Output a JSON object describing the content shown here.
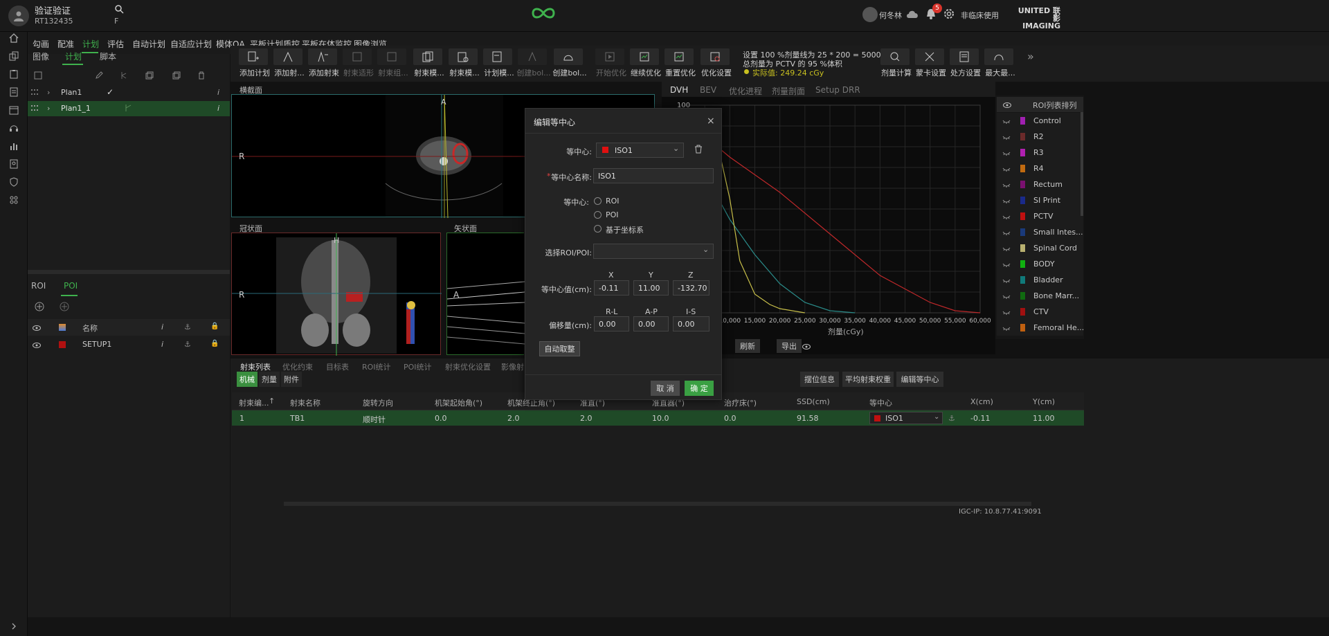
{
  "header": {
    "patient_name": "验证验证",
    "patient_id": "RT132435",
    "patient_sex": "F",
    "user_name": "何冬林",
    "notification_count": "5",
    "mode_label": "非临床使用",
    "brand_line1": "UNITED 联影",
    "brand_line2": "IMAGING"
  },
  "menu": [
    "勾画",
    "配准",
    "计划",
    "评估",
    "自动计划",
    "自适应计划",
    "模体QA",
    "平板计划质控",
    "平板在体监控",
    "图像浏览"
  ],
  "left_panel": {
    "tabs": [
      "图像",
      "计划",
      "脚本"
    ],
    "plans": [
      {
        "name": "Plan1",
        "info": "i"
      },
      {
        "name": "Plan1_1",
        "info": "i"
      }
    ],
    "lower_tabs": [
      "ROI",
      "POI"
    ],
    "poi_header": {
      "name": "名称",
      "info": "i"
    },
    "poi_rows": [
      {
        "name": "SETUP1",
        "info": "i"
      }
    ]
  },
  "toolbar": {
    "items": [
      "添加计划",
      "添加射...",
      "添加射束",
      "射束适形",
      "射束组...",
      "射束模...",
      "射束模...",
      "计划模...",
      "创建bol...",
      "创建bol...",
      "开始优化",
      "继续优化",
      "重置优化",
      "优化设置"
    ],
    "prescription_line1": "设置 100 %剂量线为 25 * 200 = 5000 cGy",
    "prescription_line2": "总剂量为 PCTV 的 95 %体积",
    "actual_value": "实际值: 249.24 cGy",
    "right_items": [
      "剂量计算",
      "蒙卡设置",
      "处方设置",
      "最大最..."
    ],
    "more": "»"
  },
  "views": {
    "axial_title": "横截面",
    "coronal_title": "冠状面",
    "sagittal_title": "矢状面",
    "axial_left": "R",
    "axial_top": "A",
    "coronal_left": "R",
    "coronal_top": "H",
    "sagittal_left": "A"
  },
  "dvh_tabs": [
    "DVH",
    "BEV",
    "优化进程",
    "剂量剖面",
    "Setup DRR"
  ],
  "chart_data": {
    "type": "line",
    "xlabel": "剂量(cGy)",
    "ylabel": "",
    "x_ticks": [
      "10,000",
      "15,000",
      "20,000",
      "25,000",
      "30,000",
      "35,000",
      "40,000",
      "45,000",
      "50,000",
      "55,000",
      "60,000"
    ],
    "y_tick_top": "100",
    "xlim": [
      0,
      60000
    ],
    "ylim": [
      0,
      100
    ],
    "series": [
      {
        "color": "#c0282a",
        "x": [
          7500,
          10000,
          20000,
          30000,
          40000,
          50000,
          55000,
          60000
        ],
        "y": [
          80,
          75,
          58,
          38,
          18,
          5,
          1,
          0
        ]
      },
      {
        "color": "#2a8c8a",
        "x": [
          7500,
          10000,
          15000,
          20000,
          25000,
          30000,
          35000
        ],
        "y": [
          56,
          45,
          28,
          14,
          5,
          1,
          0
        ]
      },
      {
        "color": "#c9c04a",
        "x": [
          7500,
          10000,
          12000,
          15000,
          18000,
          20000,
          25000
        ],
        "y": [
          82,
          55,
          25,
          9,
          4,
          2,
          0
        ]
      }
    ]
  },
  "dvh_footer": {
    "refresh": "刷新",
    "export": "导出"
  },
  "roi_list": {
    "header": "ROI列表排列",
    "items": [
      {
        "name": "Control",
        "color": "#a020b0"
      },
      {
        "name": "R2",
        "color": "#6b2a2a"
      },
      {
        "name": "R3",
        "color": "#b020b0"
      },
      {
        "name": "R4",
        "color": "#c06a10"
      },
      {
        "name": "Rectum",
        "color": "#7a1070"
      },
      {
        "name": "SI Print",
        "color": "#1a2a8a"
      },
      {
        "name": "PCTV",
        "color": "#c01010"
      },
      {
        "name": "Small Intes...",
        "color": "#1a3a7a"
      },
      {
        "name": "Spinal Cord",
        "color": "#b8b070"
      },
      {
        "name": "BODY",
        "color": "#10b010"
      },
      {
        "name": "Bladder",
        "color": "#107a7a"
      },
      {
        "name": "Bone Marr...",
        "color": "#106a10"
      },
      {
        "name": "CTV",
        "color": "#a01010"
      },
      {
        "name": "Femoral He...",
        "color": "#c06010"
      }
    ]
  },
  "bottom": {
    "tabs": [
      "射束列表",
      "优化约束",
      "目标表",
      "ROI统计",
      "POI统计",
      "射束优化设置",
      "影像射"
    ],
    "subtabs": [
      "机械",
      "剂量",
      "附件"
    ],
    "right_buttons": [
      "摆位信息",
      "平均射束权重",
      "编辑等中心"
    ],
    "columns": [
      "射束编...",
      "射束名称",
      "旋转方向",
      "机架起始角(°)",
      "机架终止角(°)",
      "准直(°)",
      "准直器(°)",
      "治疗床(°)",
      "SSD(cm)",
      "等中心",
      "X(cm)",
      "Y(cm)"
    ],
    "row": [
      "1",
      "TB1",
      "顺时针",
      "0.0",
      "2.0",
      "2.0",
      "10.0",
      "0.0",
      "91.58",
      "ISO1",
      "-0.11",
      "11.00"
    ]
  },
  "dialog": {
    "title": "编辑等中心",
    "iso_label": "等中心:",
    "iso_value": "ISO1",
    "name_label": "等中心名称:",
    "name_value": "ISO1",
    "mode_label": "等中心:",
    "options": [
      "ROI",
      "POI",
      "基于坐标系"
    ],
    "select_label": "选择ROI/POI:",
    "axis_x": "X",
    "axis_y": "Y",
    "axis_z": "Z",
    "coord_label": "等中心值(cm):",
    "x_value": "-0.11",
    "y_value": "11.00",
    "z_value": "-132.70",
    "offset_rl": "R-L",
    "offset_ap": "A-P",
    "offset_is": "I-S",
    "offset_label": "偏移量(cm):",
    "rl_value": "0.00",
    "ap_value": "0.00",
    "is_value": "0.00",
    "auto_button": "自动取整",
    "cancel": "取 消",
    "ok": "确 定"
  },
  "status": {
    "igc_ip": "IGC-IP: 10.8.77.41:9091"
  }
}
